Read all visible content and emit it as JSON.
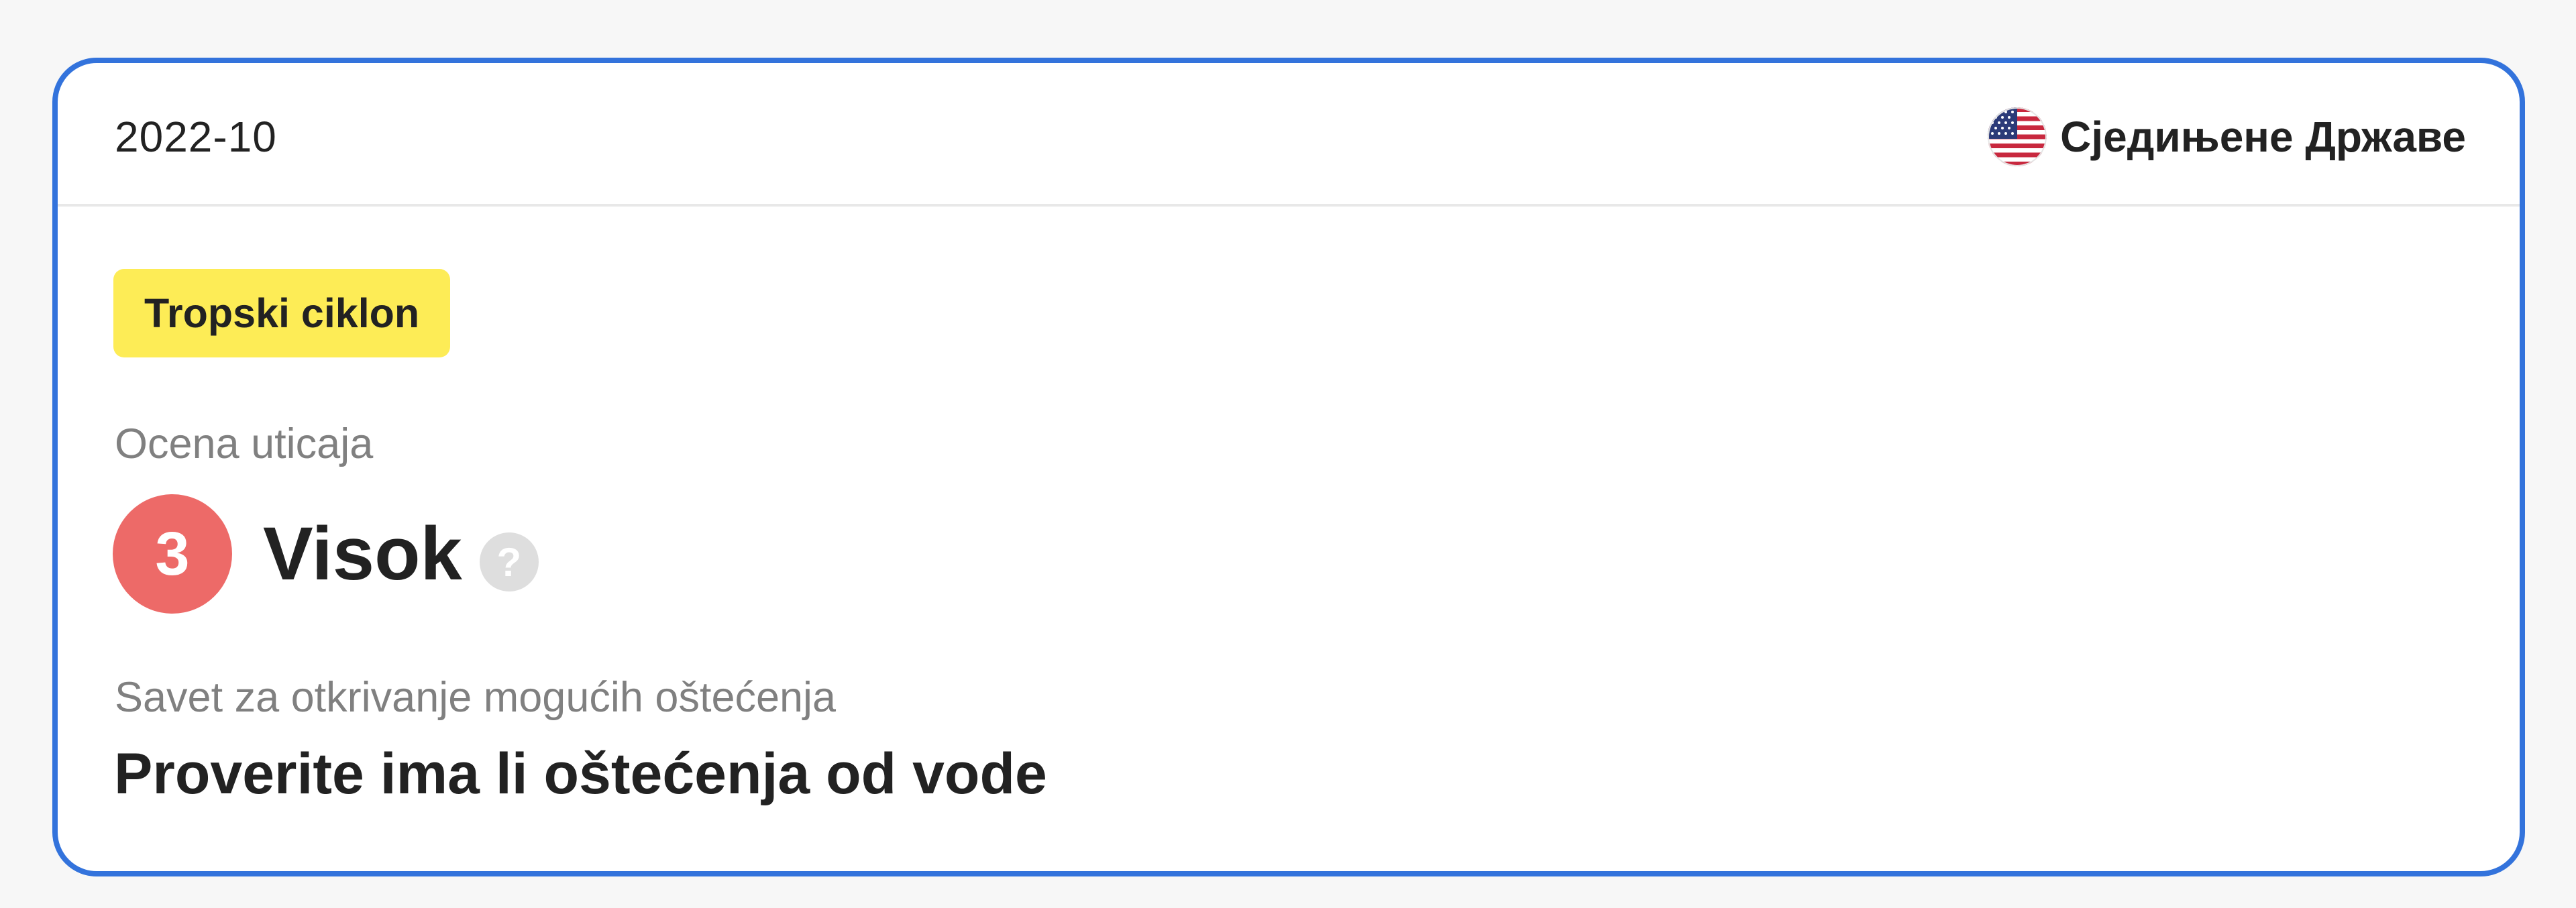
{
  "card": {
    "date": "2022-10",
    "country": {
      "name": "Сједињене Државе",
      "flag_icon": "us-flag-icon"
    },
    "tag": {
      "label": "Tropski ciklon",
      "color": "#fdec56"
    },
    "impact": {
      "label": "Ocena uticaja",
      "level_number": "3",
      "level_text": "Visok",
      "level_color": "#ed6a68",
      "help_icon": "question-icon",
      "help_glyph": "?"
    },
    "advice": {
      "label": "Savet za otkrivanje mogućih oštećenja",
      "text": "Proverite ima li oštećenja od vode"
    },
    "border_color": "#3373dc"
  }
}
